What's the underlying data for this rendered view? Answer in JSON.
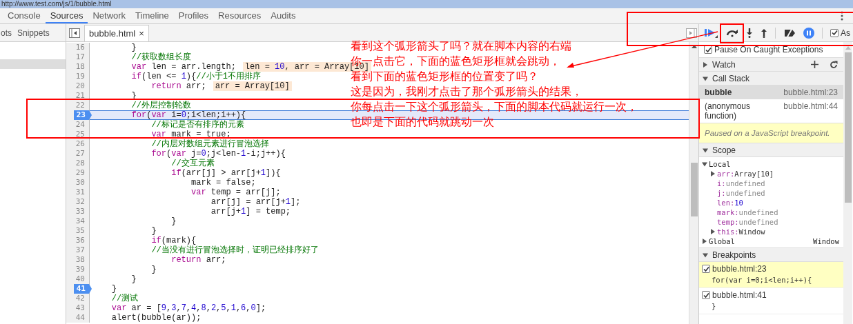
{
  "address_bar": {
    "url": "http://www.test.com/js/1/bubble.html"
  },
  "tabs": [
    {
      "label": "Console",
      "selected": false
    },
    {
      "label": "Sources",
      "selected": true
    },
    {
      "label": "Network",
      "selected": false
    },
    {
      "label": "Timeline",
      "selected": false
    },
    {
      "label": "Profiles",
      "selected": false
    },
    {
      "label": "Resources",
      "selected": false
    },
    {
      "label": "Audits",
      "selected": false
    }
  ],
  "navigator": {
    "tabs": [
      "ots",
      "Snippets"
    ]
  },
  "editor": {
    "file_tab": {
      "label": "bubble.html",
      "close": "×"
    },
    "lines": [
      {
        "n": "16",
        "breakpoint": false,
        "current": false,
        "t": [
          {
            "kind": "p",
            "text": "        }"
          }
        ]
      },
      {
        "n": "17",
        "breakpoint": false,
        "current": false,
        "t": [
          {
            "kind": "cm",
            "text": "        //获取数组长度"
          }
        ]
      },
      {
        "n": "18",
        "breakpoint": false,
        "current": false,
        "t": [
          {
            "kind": "kw",
            "text": "        var"
          },
          {
            "kind": "p",
            "text": " len = arr.length;"
          }
        ],
        "inline": [
          {
            "kind": "p",
            "text": "len = "
          },
          {
            "kind": "num",
            "text": "10"
          },
          {
            "kind": "p",
            "text": ", arr = Array[10]"
          }
        ]
      },
      {
        "n": "19",
        "breakpoint": false,
        "current": false,
        "t": [
          {
            "kind": "kw",
            "text": "        if"
          },
          {
            "kind": "p",
            "text": "(len <= "
          },
          {
            "kind": "num",
            "text": "1"
          },
          {
            "kind": "p",
            "text": "){"
          },
          {
            "kind": "cm",
            "text": "//小于1不用排序"
          }
        ]
      },
      {
        "n": "20",
        "breakpoint": false,
        "current": false,
        "t": [
          {
            "kind": "kw",
            "text": "            return"
          },
          {
            "kind": "p",
            "text": " arr;"
          }
        ],
        "inline": [
          {
            "kind": "p",
            "text": "arr = Array[10]"
          }
        ]
      },
      {
        "n": "21",
        "breakpoint": false,
        "current": false,
        "t": [
          {
            "kind": "p",
            "text": "        }"
          }
        ]
      },
      {
        "n": "22",
        "breakpoint": false,
        "current": false,
        "t": [
          {
            "kind": "cm",
            "text": "        //外层控制轮数"
          }
        ]
      },
      {
        "n": "23",
        "breakpoint": true,
        "current": true,
        "t": [
          {
            "kind": "kw",
            "text": "        for"
          },
          {
            "kind": "p",
            "text": "("
          },
          {
            "kind": "kw",
            "text": "var"
          },
          {
            "kind": "p",
            "text": " i="
          },
          {
            "kind": "num",
            "text": "0"
          },
          {
            "kind": "p",
            "text": ";i<len;i++){"
          }
        ]
      },
      {
        "n": "24",
        "breakpoint": false,
        "current": false,
        "t": [
          {
            "kind": "cm",
            "text": "            //标记是否有排序的元素"
          }
        ]
      },
      {
        "n": "25",
        "breakpoint": false,
        "current": false,
        "t": [
          {
            "kind": "kw",
            "text": "            var"
          },
          {
            "kind": "p",
            "text": " mark = true;"
          }
        ]
      },
      {
        "n": "26",
        "breakpoint": false,
        "current": false,
        "t": [
          {
            "kind": "cm",
            "text": "            //内层对数组元素进行冒泡选择"
          }
        ]
      },
      {
        "n": "27",
        "breakpoint": false,
        "current": false,
        "t": [
          {
            "kind": "kw",
            "text": "            for"
          },
          {
            "kind": "p",
            "text": "("
          },
          {
            "kind": "kw",
            "text": "var"
          },
          {
            "kind": "p",
            "text": " j="
          },
          {
            "kind": "num",
            "text": "0"
          },
          {
            "kind": "p",
            "text": ";j<len-"
          },
          {
            "kind": "num",
            "text": "1"
          },
          {
            "kind": "p",
            "text": "-i;j++){"
          }
        ]
      },
      {
        "n": "28",
        "breakpoint": false,
        "current": false,
        "t": [
          {
            "kind": "cm",
            "text": "                //交互元素"
          }
        ]
      },
      {
        "n": "29",
        "breakpoint": false,
        "current": false,
        "t": [
          {
            "kind": "kw",
            "text": "                if"
          },
          {
            "kind": "p",
            "text": "(arr[j] > arr[j+"
          },
          {
            "kind": "num",
            "text": "1"
          },
          {
            "kind": "p",
            "text": "]){"
          }
        ]
      },
      {
        "n": "30",
        "breakpoint": false,
        "current": false,
        "t": [
          {
            "kind": "p",
            "text": "                    mark = false;"
          }
        ]
      },
      {
        "n": "31",
        "breakpoint": false,
        "current": false,
        "t": [
          {
            "kind": "kw",
            "text": "                    var"
          },
          {
            "kind": "p",
            "text": " temp = arr[j];"
          }
        ]
      },
      {
        "n": "32",
        "breakpoint": false,
        "current": false,
        "t": [
          {
            "kind": "p",
            "text": "                        arr[j] = arr[j+"
          },
          {
            "kind": "num",
            "text": "1"
          },
          {
            "kind": "p",
            "text": "];"
          }
        ]
      },
      {
        "n": "33",
        "breakpoint": false,
        "current": false,
        "t": [
          {
            "kind": "p",
            "text": "                        arr[j+"
          },
          {
            "kind": "num",
            "text": "1"
          },
          {
            "kind": "p",
            "text": "] = temp;"
          }
        ]
      },
      {
        "n": "34",
        "breakpoint": false,
        "current": false,
        "t": [
          {
            "kind": "p",
            "text": "                }"
          }
        ]
      },
      {
        "n": "35",
        "breakpoint": false,
        "current": false,
        "t": [
          {
            "kind": "p",
            "text": "            }"
          }
        ]
      },
      {
        "n": "36",
        "breakpoint": false,
        "current": false,
        "t": [
          {
            "kind": "kw",
            "text": "            if"
          },
          {
            "kind": "p",
            "text": "(mark){"
          }
        ]
      },
      {
        "n": "37",
        "breakpoint": false,
        "current": false,
        "t": [
          {
            "kind": "cm",
            "text": "            //当没有进行冒泡选择时，证明已经排序好了"
          }
        ]
      },
      {
        "n": "38",
        "breakpoint": false,
        "current": false,
        "t": [
          {
            "kind": "kw",
            "text": "                return"
          },
          {
            "kind": "p",
            "text": " arr;"
          }
        ]
      },
      {
        "n": "39",
        "breakpoint": false,
        "current": false,
        "t": [
          {
            "kind": "p",
            "text": "            }"
          }
        ]
      },
      {
        "n": "40",
        "breakpoint": false,
        "current": false,
        "t": [
          {
            "kind": "p",
            "text": "        }"
          }
        ]
      },
      {
        "n": "41",
        "breakpoint": true,
        "current": false,
        "t": [
          {
            "kind": "p",
            "text": "    }"
          }
        ]
      },
      {
        "n": "42",
        "breakpoint": false,
        "current": false,
        "t": [
          {
            "kind": "cm",
            "text": "    //测试"
          }
        ]
      },
      {
        "n": "43",
        "breakpoint": false,
        "current": false,
        "t": [
          {
            "kind": "kw",
            "text": "    var"
          },
          {
            "kind": "p",
            "text": " ar = ["
          },
          {
            "kind": "num",
            "text": "9"
          },
          {
            "kind": "p",
            "text": ","
          },
          {
            "kind": "num",
            "text": "3"
          },
          {
            "kind": "p",
            "text": ","
          },
          {
            "kind": "num",
            "text": "7"
          },
          {
            "kind": "p",
            "text": ","
          },
          {
            "kind": "num",
            "text": "4"
          },
          {
            "kind": "p",
            "text": ","
          },
          {
            "kind": "num",
            "text": "8"
          },
          {
            "kind": "p",
            "text": ","
          },
          {
            "kind": "num",
            "text": "2"
          },
          {
            "kind": "p",
            "text": ","
          },
          {
            "kind": "num",
            "text": "5"
          },
          {
            "kind": "p",
            "text": ","
          },
          {
            "kind": "num",
            "text": "1"
          },
          {
            "kind": "p",
            "text": ","
          },
          {
            "kind": "num",
            "text": "6"
          },
          {
            "kind": "p",
            "text": ","
          },
          {
            "kind": "num",
            "text": "0"
          },
          {
            "kind": "p",
            "text": "];"
          }
        ]
      },
      {
        "n": "44",
        "breakpoint": false,
        "current": false,
        "t": [
          {
            "kind": "p",
            "text": "    alert(bubble(ar));"
          }
        ]
      }
    ]
  },
  "debugger": {
    "async_label": "As",
    "async_checked": true,
    "pause_on_caught": {
      "label": "Pause On Caught Exceptions",
      "checked": true
    },
    "watch": {
      "title": "Watch",
      "expanded": false
    },
    "call_stack": {
      "title": "Call Stack",
      "expanded": true,
      "frames": [
        {
          "name": "bubble",
          "location": "bubble.html:23",
          "selected": true
        },
        {
          "name": "(anonymous function)",
          "location": "bubble.html:44",
          "selected": false
        }
      ]
    },
    "paused_message": "Paused on a JavaScript breakpoint.",
    "scope": {
      "title": "Scope",
      "expanded": true,
      "groups": [
        {
          "name": "Local",
          "expanded": true,
          "vars": [
            {
              "name": "arr:",
              "value": "Array[10]",
              "kind": "object",
              "expandable": true
            },
            {
              "name": "i:",
              "value": "undefined",
              "kind": "undefined",
              "expandable": false
            },
            {
              "name": "j:",
              "value": "undefined",
              "kind": "undefined",
              "expandable": false
            },
            {
              "name": "len:",
              "value": "10",
              "kind": "number",
              "expandable": false
            },
            {
              "name": "mark:",
              "value": "undefined",
              "kind": "undefined",
              "expandable": false
            },
            {
              "name": "temp:",
              "value": "undefined",
              "kind": "undefined",
              "expandable": false
            },
            {
              "name": "this:",
              "value": "Window",
              "kind": "object",
              "expandable": true
            }
          ]
        },
        {
          "name": "Global",
          "expanded": false,
          "value": "Window"
        }
      ]
    },
    "breakpoints": {
      "title": "Breakpoints",
      "expanded": true,
      "items": [
        {
          "location": "bubble.html:23",
          "code": "for(var i=0;i<len;i++){",
          "checked": true,
          "selected": true
        },
        {
          "location": "bubble.html:41",
          "code": "}",
          "checked": true,
          "selected": false
        }
      ]
    }
  },
  "annotation": {
    "lines": [
      "看到这个弧形箭头了吗？就在脚本内容的右端",
      "你一点击它，下面的蓝色矩形框就会跳动，",
      "看到下面的蓝色矩形框的位置变了吗？",
      "这是因为，我刚才点击了那个弧形箭头的结果，",
      "你每点击一下这个弧形箭头，下面的脚本代码就运行一次，",
      "也即是下面的代码就跳动一次"
    ]
  }
}
